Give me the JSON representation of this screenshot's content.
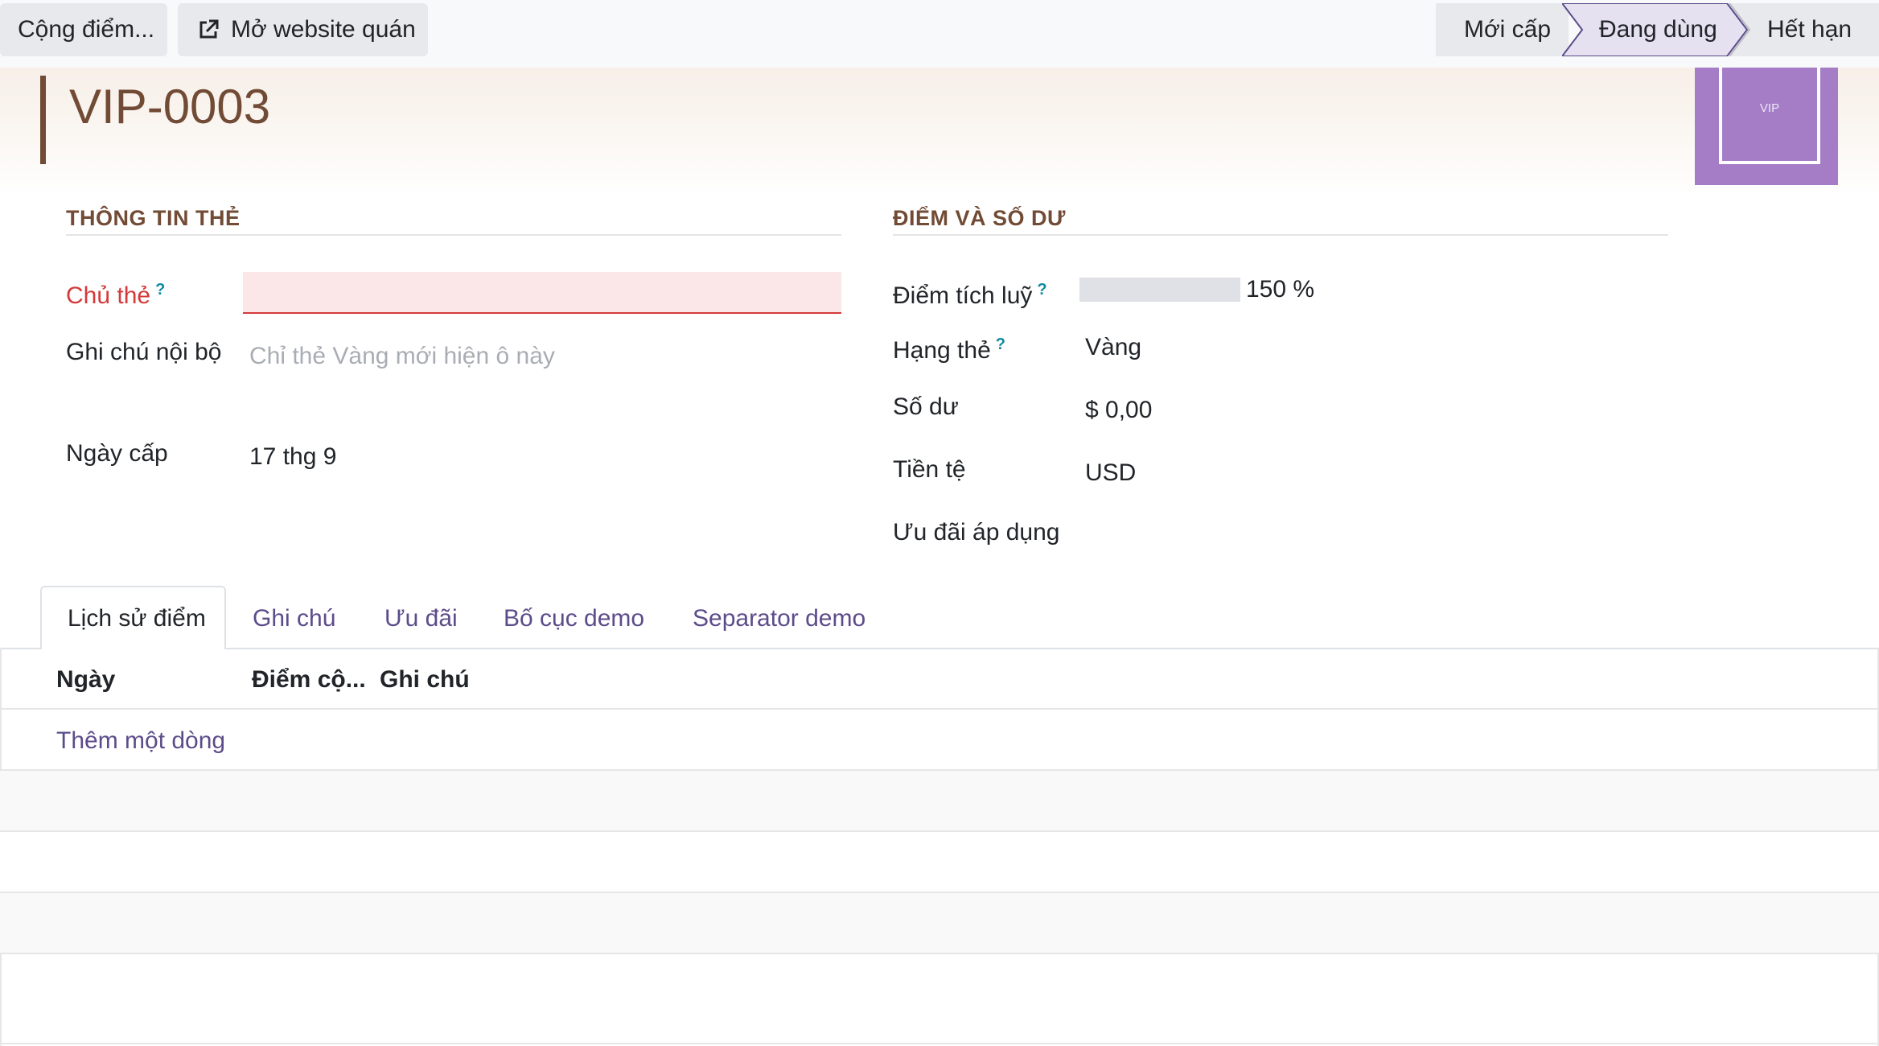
{
  "toolbar": {
    "add_points_label": "Cộng điểm...",
    "open_website_label": "Mở website quán"
  },
  "statusbar": {
    "stages": [
      "Mới cấp",
      "Đang dùng",
      "Hết hạn"
    ],
    "active_stage": "Đang dùng"
  },
  "record": {
    "title": "VIP-0003",
    "image_text": "VIP"
  },
  "sections": {
    "card_info": "THÔNG TIN THẺ",
    "points_balance": "ĐIỂM VÀ SỐ DƯ"
  },
  "fields": {
    "holder": {
      "label": "Chủ thẻ",
      "help": "?",
      "value": ""
    },
    "internal_note": {
      "label": "Ghi chú nội bộ",
      "placeholder": "Chỉ thẻ Vàng mới hiện ô này"
    },
    "issue_date": {
      "label": "Ngày cấp",
      "value": "17 thg 9"
    },
    "points": {
      "label": "Điểm tích luỹ",
      "help": "?",
      "percent_text": "150 %",
      "progress_percent": 150
    },
    "tier": {
      "label": "Hạng thẻ",
      "help": "?",
      "value": "Vàng"
    },
    "balance": {
      "label": "Số dư",
      "value": "$ 0,00"
    },
    "currency": {
      "label": "Tiền tệ",
      "value": "USD"
    },
    "offers": {
      "label": "Ưu đãi áp dụng",
      "value": ""
    }
  },
  "tabs": [
    "Lịch sử điểm",
    "Ghi chú",
    "Ưu đãi",
    "Bố cục demo",
    "Separator demo"
  ],
  "active_tab": "Lịch sử điểm",
  "table": {
    "columns": [
      "Ngày",
      "Điểm cộ...",
      "Ghi chú"
    ],
    "add_line": "Thêm một dòng"
  },
  "colors": {
    "brand": "#714b35",
    "accent": "#5c4c8a",
    "avatar": "#a47dc6",
    "required": "#d43a3a"
  }
}
